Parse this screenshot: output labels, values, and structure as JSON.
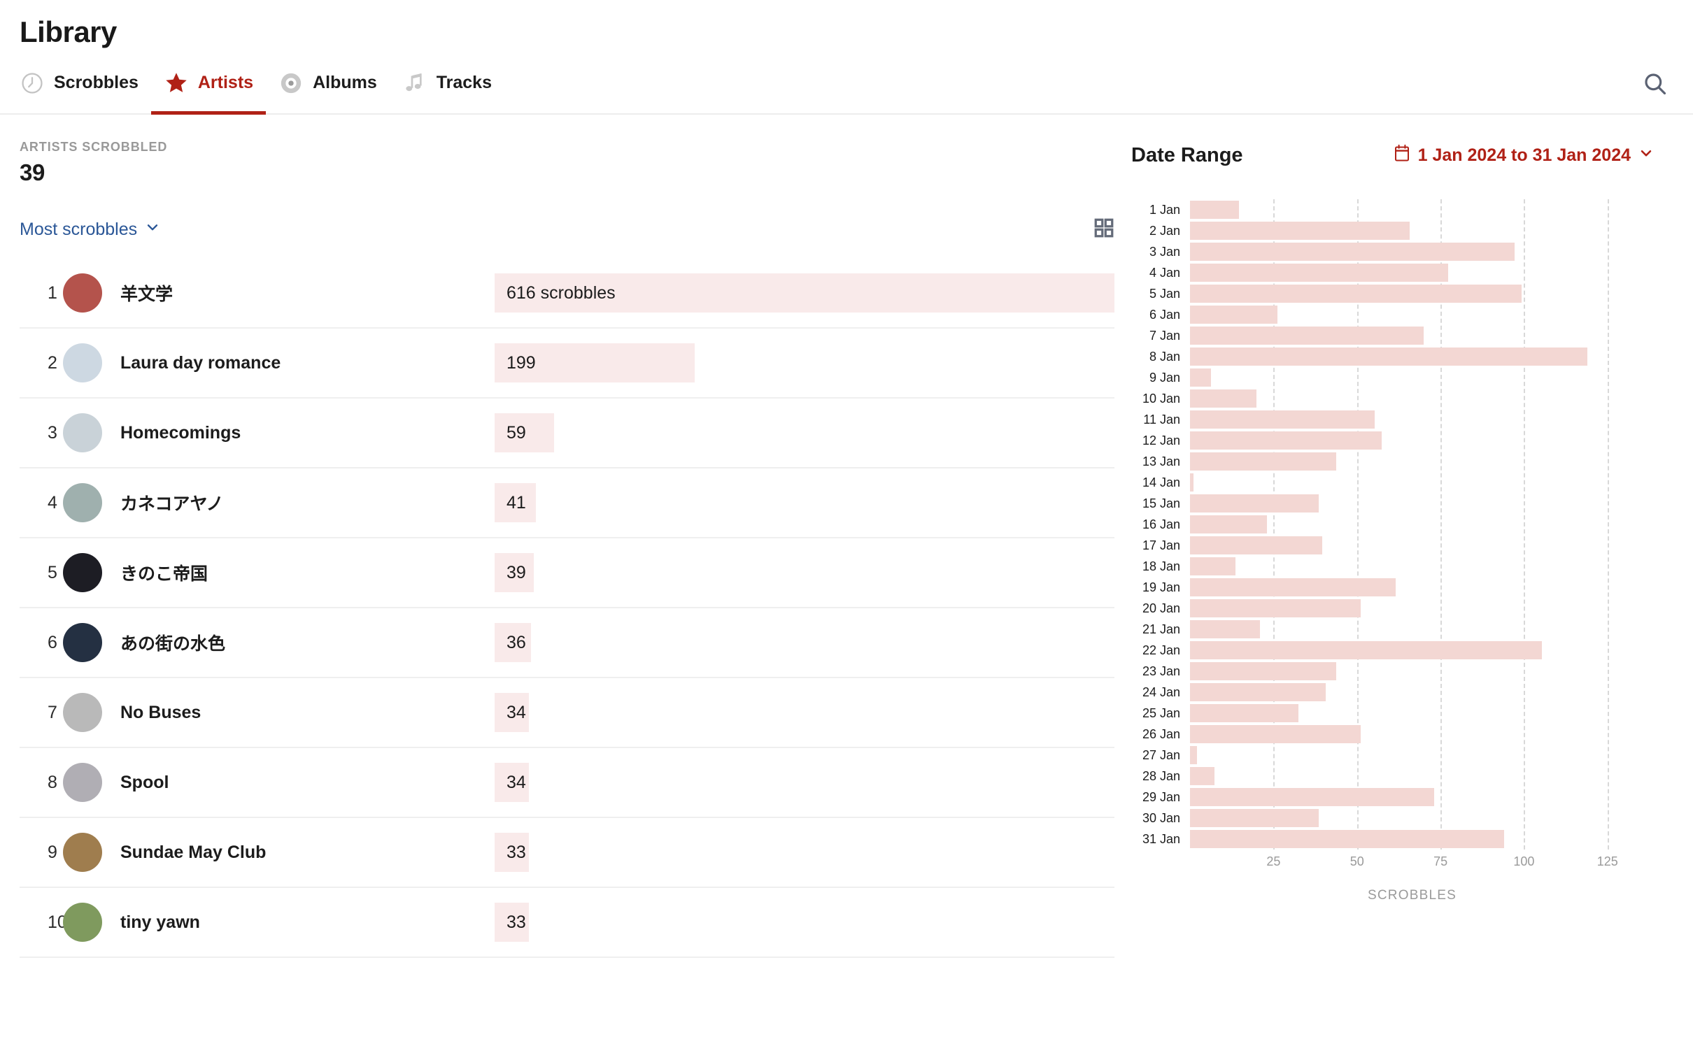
{
  "header": {
    "title": "Library",
    "search_icon": "search-icon",
    "tabs": [
      {
        "label": "Scrobbles",
        "icon": "clock-icon",
        "active": false
      },
      {
        "label": "Artists",
        "icon": "star-icon",
        "active": true
      },
      {
        "label": "Albums",
        "icon": "vinyl-record-icon",
        "active": false
      },
      {
        "label": "Tracks",
        "icon": "music-note-icon",
        "active": false
      }
    ]
  },
  "stats": {
    "label": "ARTISTS SCROBBLED",
    "value": "39"
  },
  "controls": {
    "sort_label": "Most scrobbles",
    "sort_chevron": "chevron-down-icon",
    "grid_toggle_icon": "grid-view-icon"
  },
  "artists": [
    {
      "rank": "1",
      "name": "羊文学",
      "count": "616",
      "count_label": "616 scrobbles",
      "avatar": "#b4534c"
    },
    {
      "rank": "2",
      "name": "Laura day romance",
      "count": "199",
      "count_label": "199",
      "avatar": "#cdd8e2"
    },
    {
      "rank": "3",
      "name": "Homecomings",
      "count": "59",
      "count_label": "59",
      "avatar": "#c9d2d8"
    },
    {
      "rank": "4",
      "name": "カネコアヤノ",
      "count": "41",
      "count_label": "41",
      "avatar": "#9fb0ae"
    },
    {
      "rank": "5",
      "name": "きのこ帝国",
      "count": "39",
      "count_label": "39",
      "avatar": "#1d1d24"
    },
    {
      "rank": "6",
      "name": "あの街の水色",
      "count": "36",
      "count_label": "36",
      "avatar": "#243042"
    },
    {
      "rank": "7",
      "name": "No Buses",
      "count": "34",
      "count_label": "34",
      "avatar": "#b9b9b9"
    },
    {
      "rank": "8",
      "name": "Spool",
      "count": "34",
      "count_label": "34",
      "avatar": "#b0aeb4"
    },
    {
      "rank": "9",
      "name": "Sundae May Club",
      "count": "33",
      "count_label": "33",
      "avatar": "#9f7d4e"
    },
    {
      "rank": "10",
      "name": "tiny yawn",
      "count": "33",
      "count_label": "33",
      "avatar": "#7f9a5e"
    }
  ],
  "date_range": {
    "title": "Date Range",
    "calendar_icon": "calendar-icon",
    "value": "1 Jan 2024 to 31 Jan 2024",
    "chevron": "chevron-down-icon"
  },
  "colors": {
    "accent_red": "#b02116",
    "bar_pink": "#f3d7d3",
    "scrobble_bar_pink": "#f9eaea",
    "link_blue": "#2b5797",
    "muted_gray": "#9a9a9a"
  },
  "chart_data": {
    "type": "bar",
    "orientation": "horizontal",
    "title": "",
    "xlabel": "SCROBBLES",
    "ylabel": "",
    "xlim": [
      0,
      133
    ],
    "xticks": [
      25,
      50,
      75,
      100,
      125
    ],
    "grid": true,
    "legend": "none",
    "categories": [
      "1 Jan",
      "2 Jan",
      "3 Jan",
      "4 Jan",
      "5 Jan",
      "6 Jan",
      "7 Jan",
      "8 Jan",
      "9 Jan",
      "10 Jan",
      "11 Jan",
      "12 Jan",
      "13 Jan",
      "14 Jan",
      "15 Jan",
      "16 Jan",
      "17 Jan",
      "18 Jan",
      "19 Jan",
      "20 Jan",
      "21 Jan",
      "22 Jan",
      "23 Jan",
      "24 Jan",
      "25 Jan",
      "26 Jan",
      "27 Jan",
      "28 Jan",
      "29 Jan",
      "30 Jan",
      "31 Jan"
    ],
    "values": [
      14,
      63,
      93,
      74,
      95,
      25,
      67,
      114,
      6,
      19,
      53,
      55,
      42,
      1,
      37,
      22,
      38,
      13,
      59,
      49,
      20,
      101,
      42,
      39,
      31,
      49,
      2,
      7,
      70,
      37,
      90
    ]
  }
}
